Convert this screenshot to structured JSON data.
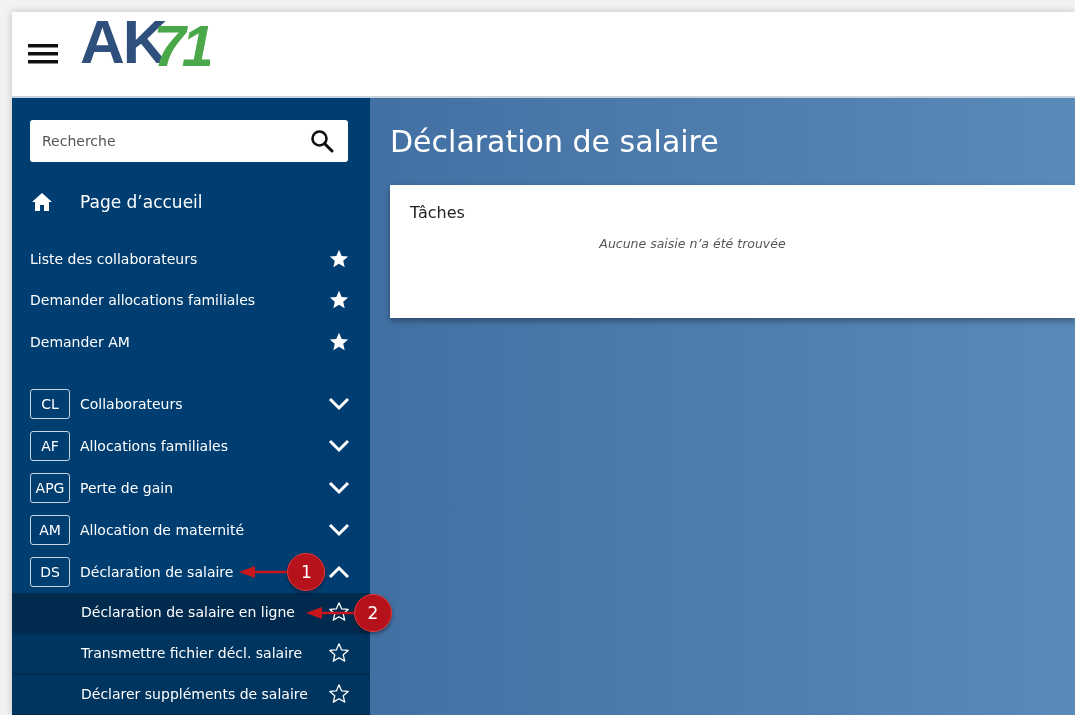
{
  "header": {
    "logo": {
      "main": "AK",
      "accent": "71"
    }
  },
  "sidebar": {
    "search": {
      "placeholder": "Recherche"
    },
    "home": {
      "label": "Page d’accueil"
    },
    "favorites": [
      {
        "label": "Liste des collaborateurs",
        "starred": true
      },
      {
        "label": "Demander allocations familiales",
        "starred": true
      },
      {
        "label": "Demander AM",
        "starred": true
      }
    ],
    "sections": [
      {
        "code": "CL",
        "label": "Collaborateurs",
        "expanded": false
      },
      {
        "code": "AF",
        "label": "Allocations familiales",
        "expanded": false
      },
      {
        "code": "APG",
        "label": "Perte de gain",
        "expanded": false
      },
      {
        "code": "AM",
        "label": "Allocation de maternité",
        "expanded": false
      },
      {
        "code": "DS",
        "label": "Déclaration de salaire",
        "expanded": true,
        "callout": "1",
        "children": [
          {
            "label": "Déclaration de salaire en ligne",
            "selected": true,
            "starred": false,
            "callout": "2"
          },
          {
            "label": "Transmettre fichier décl. salaire",
            "selected": false,
            "starred": false
          },
          {
            "label": "Déclarer suppléments de salaire",
            "selected": false,
            "starred": false
          }
        ]
      }
    ]
  },
  "main": {
    "title": "Déclaration de salaire",
    "card": {
      "title": "Tâches",
      "empty_message": "Aucune saisie n’a été trouvée"
    }
  }
}
